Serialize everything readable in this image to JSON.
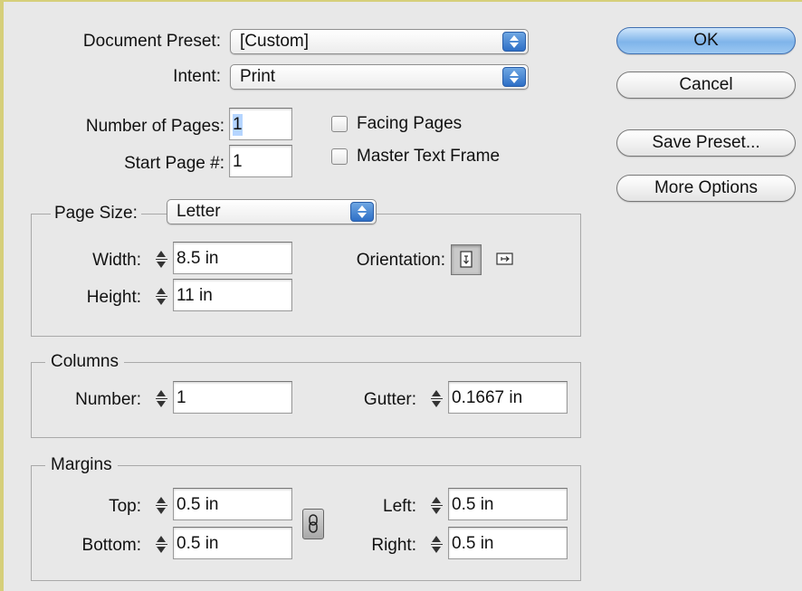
{
  "preset": {
    "label": "Document Preset:",
    "value": "[Custom]"
  },
  "intent": {
    "label": "Intent:",
    "value": "Print"
  },
  "pages": {
    "number_label": "Number of Pages:",
    "number_value": "1",
    "start_label": "Start Page #:",
    "start_value": "1",
    "facing_label": "Facing Pages",
    "master_label": "Master Text Frame"
  },
  "page_size": {
    "label": "Page Size:",
    "value": "Letter",
    "width_label": "Width:",
    "width_value": "8.5 in",
    "height_label": "Height:",
    "height_value": "11 in",
    "orientation_label": "Orientation:"
  },
  "columns": {
    "title": "Columns",
    "number_label": "Number:",
    "number_value": "1",
    "gutter_label": "Gutter:",
    "gutter_value": "0.1667 in"
  },
  "margins": {
    "title": "Margins",
    "top_label": "Top:",
    "top_value": "0.5 in",
    "bottom_label": "Bottom:",
    "bottom_value": "0.5 in",
    "left_label": "Left:",
    "left_value": "0.5 in",
    "right_label": "Right:",
    "right_value": "0.5 in"
  },
  "buttons": {
    "ok": "OK",
    "cancel": "Cancel",
    "save_preset": "Save Preset...",
    "more_options": "More Options"
  },
  "icons": {
    "popup": "popup-arrows-icon",
    "stepper": "stepper-icon",
    "portrait": "portrait-orientation-icon",
    "landscape": "landscape-orientation-icon",
    "link": "chain-link-icon"
  },
  "colors": {
    "accent": "#2e6fc6",
    "default_button": "#7fb4ea",
    "background": "#e8e8e8"
  }
}
